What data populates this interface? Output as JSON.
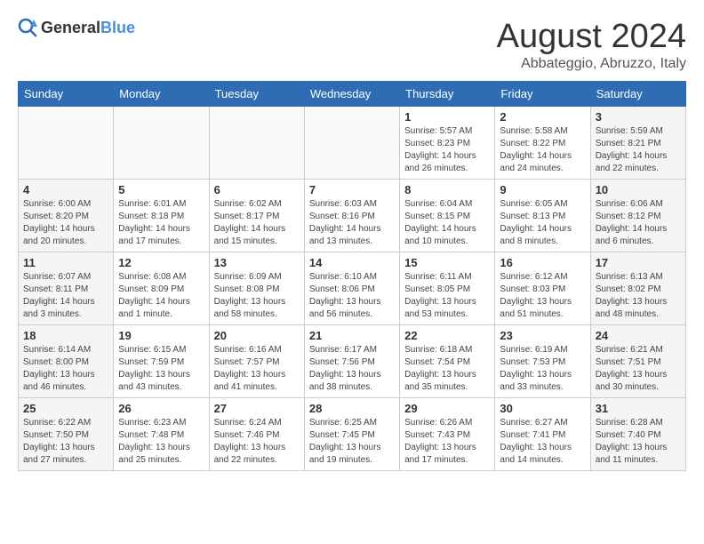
{
  "header": {
    "logo_general": "General",
    "logo_blue": "Blue",
    "month_year": "August 2024",
    "location": "Abbateggio, Abruzzo, Italy"
  },
  "days_of_week": [
    "Sunday",
    "Monday",
    "Tuesday",
    "Wednesday",
    "Thursday",
    "Friday",
    "Saturday"
  ],
  "weeks": [
    [
      {
        "day": "",
        "info": ""
      },
      {
        "day": "",
        "info": ""
      },
      {
        "day": "",
        "info": ""
      },
      {
        "day": "",
        "info": ""
      },
      {
        "day": "1",
        "info": "Sunrise: 5:57 AM\nSunset: 8:23 PM\nDaylight: 14 hours and 26 minutes."
      },
      {
        "day": "2",
        "info": "Sunrise: 5:58 AM\nSunset: 8:22 PM\nDaylight: 14 hours and 24 minutes."
      },
      {
        "day": "3",
        "info": "Sunrise: 5:59 AM\nSunset: 8:21 PM\nDaylight: 14 hours and 22 minutes."
      }
    ],
    [
      {
        "day": "4",
        "info": "Sunrise: 6:00 AM\nSunset: 8:20 PM\nDaylight: 14 hours and 20 minutes."
      },
      {
        "day": "5",
        "info": "Sunrise: 6:01 AM\nSunset: 8:18 PM\nDaylight: 14 hours and 17 minutes."
      },
      {
        "day": "6",
        "info": "Sunrise: 6:02 AM\nSunset: 8:17 PM\nDaylight: 14 hours and 15 minutes."
      },
      {
        "day": "7",
        "info": "Sunrise: 6:03 AM\nSunset: 8:16 PM\nDaylight: 14 hours and 13 minutes."
      },
      {
        "day": "8",
        "info": "Sunrise: 6:04 AM\nSunset: 8:15 PM\nDaylight: 14 hours and 10 minutes."
      },
      {
        "day": "9",
        "info": "Sunrise: 6:05 AM\nSunset: 8:13 PM\nDaylight: 14 hours and 8 minutes."
      },
      {
        "day": "10",
        "info": "Sunrise: 6:06 AM\nSunset: 8:12 PM\nDaylight: 14 hours and 6 minutes."
      }
    ],
    [
      {
        "day": "11",
        "info": "Sunrise: 6:07 AM\nSunset: 8:11 PM\nDaylight: 14 hours and 3 minutes."
      },
      {
        "day": "12",
        "info": "Sunrise: 6:08 AM\nSunset: 8:09 PM\nDaylight: 14 hours and 1 minute."
      },
      {
        "day": "13",
        "info": "Sunrise: 6:09 AM\nSunset: 8:08 PM\nDaylight: 13 hours and 58 minutes."
      },
      {
        "day": "14",
        "info": "Sunrise: 6:10 AM\nSunset: 8:06 PM\nDaylight: 13 hours and 56 minutes."
      },
      {
        "day": "15",
        "info": "Sunrise: 6:11 AM\nSunset: 8:05 PM\nDaylight: 13 hours and 53 minutes."
      },
      {
        "day": "16",
        "info": "Sunrise: 6:12 AM\nSunset: 8:03 PM\nDaylight: 13 hours and 51 minutes."
      },
      {
        "day": "17",
        "info": "Sunrise: 6:13 AM\nSunset: 8:02 PM\nDaylight: 13 hours and 48 minutes."
      }
    ],
    [
      {
        "day": "18",
        "info": "Sunrise: 6:14 AM\nSunset: 8:00 PM\nDaylight: 13 hours and 46 minutes."
      },
      {
        "day": "19",
        "info": "Sunrise: 6:15 AM\nSunset: 7:59 PM\nDaylight: 13 hours and 43 minutes."
      },
      {
        "day": "20",
        "info": "Sunrise: 6:16 AM\nSunset: 7:57 PM\nDaylight: 13 hours and 41 minutes."
      },
      {
        "day": "21",
        "info": "Sunrise: 6:17 AM\nSunset: 7:56 PM\nDaylight: 13 hours and 38 minutes."
      },
      {
        "day": "22",
        "info": "Sunrise: 6:18 AM\nSunset: 7:54 PM\nDaylight: 13 hours and 35 minutes."
      },
      {
        "day": "23",
        "info": "Sunrise: 6:19 AM\nSunset: 7:53 PM\nDaylight: 13 hours and 33 minutes."
      },
      {
        "day": "24",
        "info": "Sunrise: 6:21 AM\nSunset: 7:51 PM\nDaylight: 13 hours and 30 minutes."
      }
    ],
    [
      {
        "day": "25",
        "info": "Sunrise: 6:22 AM\nSunset: 7:50 PM\nDaylight: 13 hours and 27 minutes."
      },
      {
        "day": "26",
        "info": "Sunrise: 6:23 AM\nSunset: 7:48 PM\nDaylight: 13 hours and 25 minutes."
      },
      {
        "day": "27",
        "info": "Sunrise: 6:24 AM\nSunset: 7:46 PM\nDaylight: 13 hours and 22 minutes."
      },
      {
        "day": "28",
        "info": "Sunrise: 6:25 AM\nSunset: 7:45 PM\nDaylight: 13 hours and 19 minutes."
      },
      {
        "day": "29",
        "info": "Sunrise: 6:26 AM\nSunset: 7:43 PM\nDaylight: 13 hours and 17 minutes."
      },
      {
        "day": "30",
        "info": "Sunrise: 6:27 AM\nSunset: 7:41 PM\nDaylight: 13 hours and 14 minutes."
      },
      {
        "day": "31",
        "info": "Sunrise: 6:28 AM\nSunset: 7:40 PM\nDaylight: 13 hours and 11 minutes."
      }
    ]
  ]
}
